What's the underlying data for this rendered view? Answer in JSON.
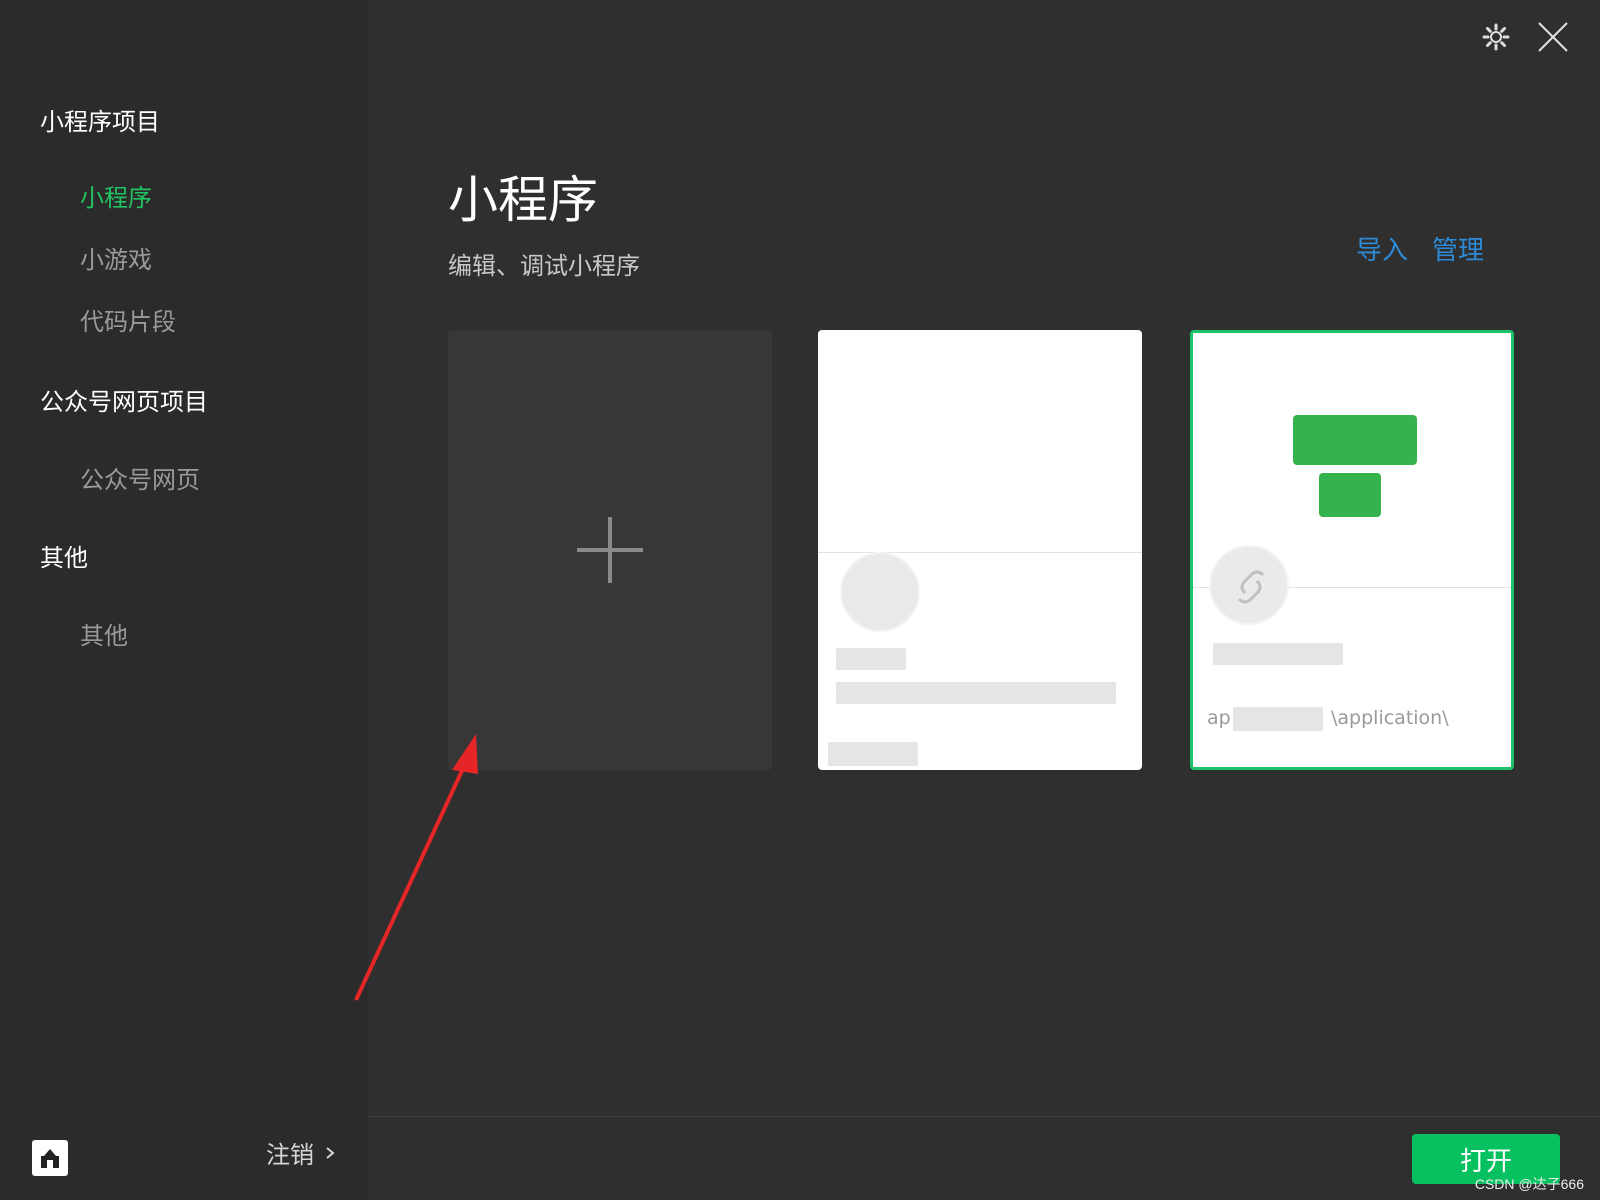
{
  "sidebar": {
    "sections": [
      {
        "title": "小程序项目",
        "items": [
          "小程序",
          "小游戏",
          "代码片段"
        ]
      },
      {
        "title": "公众号网页项目",
        "items": [
          "公众号网页"
        ]
      },
      {
        "title": "其他",
        "items": [
          "其他"
        ]
      }
    ],
    "active_item": "小程序",
    "logout_label": "注销"
  },
  "main": {
    "title": "小程序",
    "subtitle": "编辑、调试小程序",
    "actions": {
      "import": "导入",
      "manage": "管理"
    },
    "cards": [
      {
        "type": "new",
        "icon": "plus-icon"
      },
      {
        "type": "project",
        "name": "",
        "path": ""
      },
      {
        "type": "project",
        "selected": true,
        "path_fragment": "ap",
        "path_fragment2": "\\application\\"
      }
    ],
    "open_button": "打开"
  },
  "header": {
    "icons": [
      "gear-icon",
      "close-icon"
    ]
  },
  "watermark": "CSDN @达子666",
  "colors": {
    "accent": "#07c160",
    "link": "#2c8ad6",
    "arrow": "#e62626"
  }
}
